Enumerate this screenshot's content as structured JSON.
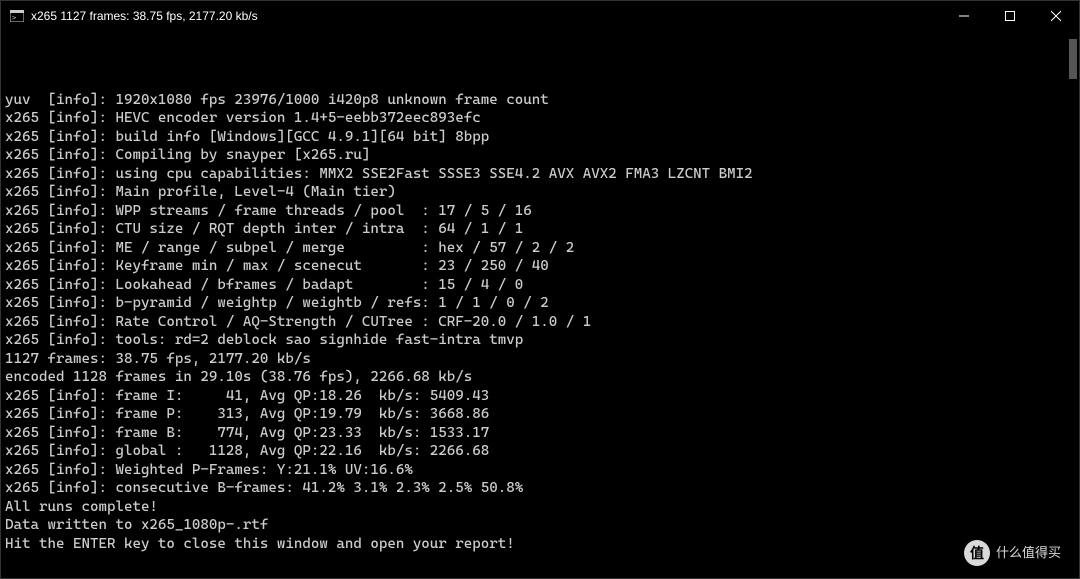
{
  "window": {
    "title": "x265 1127 frames: 38.75 fps, 2177.20 kb/s"
  },
  "terminal": {
    "lines": [
      "yuv  [info]: 1920x1080 fps 23976/1000 i420p8 unknown frame count",
      "x265 [info]: HEVC encoder version 1.4+5-eebb372eec893efc",
      "x265 [info]: build info [Windows][GCC 4.9.1][64 bit] 8bpp",
      "x265 [info]: Compiling by snayper [x265.ru]",
      "x265 [info]: using cpu capabilities: MMX2 SSE2Fast SSSE3 SSE4.2 AVX AVX2 FMA3 LZCNT BMI2",
      "x265 [info]: Main profile, Level-4 (Main tier)",
      "x265 [info]: WPP streams / frame threads / pool  : 17 / 5 / 16",
      "x265 [info]: CTU size / RQT depth inter / intra  : 64 / 1 / 1",
      "x265 [info]: ME / range / subpel / merge         : hex / 57 / 2 / 2",
      "x265 [info]: Keyframe min / max / scenecut       : 23 / 250 / 40",
      "x265 [info]: Lookahead / bframes / badapt        : 15 / 4 / 0",
      "x265 [info]: b-pyramid / weightp / weightb / refs: 1 / 1 / 0 / 2",
      "x265 [info]: Rate Control / AQ-Strength / CUTree : CRF-20.0 / 1.0 / 1",
      "x265 [info]: tools: rd=2 deblock sao signhide fast-intra tmvp",
      "1127 frames: 38.75 fps, 2177.20 kb/s",
      "encoded 1128 frames in 29.10s (38.76 fps), 2266.68 kb/s",
      "x265 [info]: frame I:     41, Avg QP:18.26  kb/s: 5409.43",
      "x265 [info]: frame P:    313, Avg QP:19.79  kb/s: 3668.86",
      "x265 [info]: frame B:    774, Avg QP:23.33  kb/s: 1533.17",
      "x265 [info]: global :   1128, Avg QP:22.16  kb/s: 2266.68",
      "x265 [info]: Weighted P-Frames: Y:21.1% UV:16.6%",
      "x265 [info]: consecutive B-frames: 41.2% 3.1% 2.3% 2.5% 50.8%",
      "",
      "",
      "All runs complete!",
      "",
      "Data written to x265_1080p-.rtf",
      "",
      "Hit the ENTER key to close this window and open your report!"
    ]
  },
  "watermark": {
    "badge": "值",
    "text": "什么值得买"
  }
}
